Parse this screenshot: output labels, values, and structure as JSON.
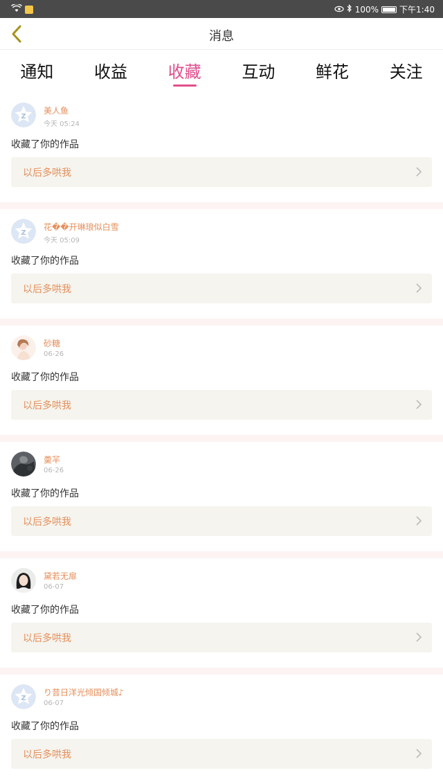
{
  "status": {
    "battery": "100%",
    "time": "下午1:40"
  },
  "header": {
    "title": "消息"
  },
  "tabs": [
    {
      "label": "通知",
      "active": false
    },
    {
      "label": "收益",
      "active": false
    },
    {
      "label": "收藏",
      "active": true
    },
    {
      "label": "互动",
      "active": false
    },
    {
      "label": "鲜花",
      "active": false
    },
    {
      "label": "关注",
      "active": false
    }
  ],
  "items": [
    {
      "name": "美人鱼",
      "time": "今天 05:24",
      "message": "收藏了你的作品",
      "work": "以后多哄我",
      "avatar": "default-star"
    },
    {
      "name": "花��开琳琅似白雪",
      "time": "今天 05:09",
      "message": "收藏了你的作品",
      "work": "以后多哄我",
      "avatar": "default-star"
    },
    {
      "name": "砂糖",
      "time": "06-26",
      "message": "收藏了你的作品",
      "work": "以后多哄我",
      "avatar": "photo-girl-light"
    },
    {
      "name": "羮羋",
      "time": "06-26",
      "message": "收藏了你的作品",
      "work": "以后多哄我",
      "avatar": "photo-dark"
    },
    {
      "name": "黛若无扉",
      "time": "06-07",
      "message": "收藏了你的作品",
      "work": "以后多哄我",
      "avatar": "photo-girl-dark"
    },
    {
      "name": "り昔日洋光倾国倾城♪",
      "time": "06-07",
      "message": "收藏了你的作品",
      "work": "以后多哄我",
      "avatar": "default-star"
    }
  ],
  "colors": {
    "accent": "#e04f8c",
    "name": "#e58e5a",
    "quote_bg": "#f5f4ee",
    "separator": "#fdf3f3"
  }
}
